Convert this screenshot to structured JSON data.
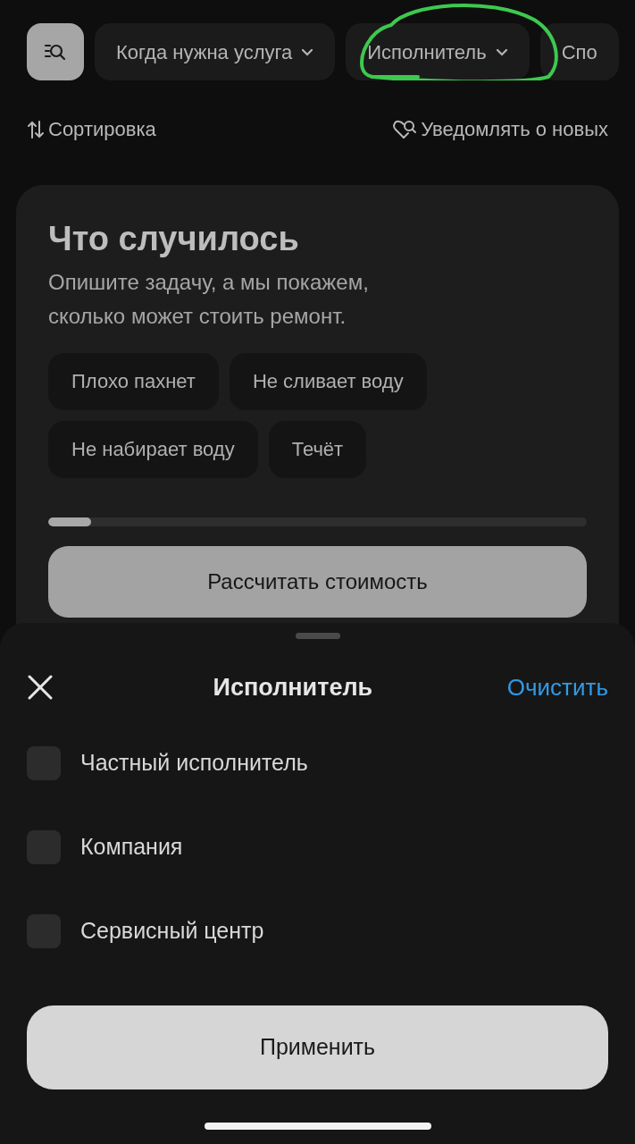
{
  "filter_chips": [
    {
      "label": "Когда нужна услуга",
      "dropdown": true
    },
    {
      "label": "Исполнитель",
      "dropdown": true
    },
    {
      "label": "Спо",
      "dropdown": false
    }
  ],
  "sort": {
    "label": "Сортировка"
  },
  "notify": {
    "label": "Уведомлять о новых"
  },
  "card": {
    "title": "Что случилось",
    "subtitle": "Опишите задачу, а мы покажем, сколько может стоить ремонт.",
    "tags": [
      "Плохо пахнет",
      "Не сливает воду",
      "Не набирает воду",
      "Течёт"
    ],
    "progress": {
      "level": 0.08
    },
    "button": "Рассчитать стоимость"
  },
  "sheet": {
    "title": "Исполнитель",
    "clear": "Очистить",
    "options": [
      {
        "label": "Частный исполнитель",
        "checked": false
      },
      {
        "label": "Компания",
        "checked": false
      },
      {
        "label": "Сервисный центр",
        "checked": false
      }
    ],
    "apply": "Применить"
  }
}
